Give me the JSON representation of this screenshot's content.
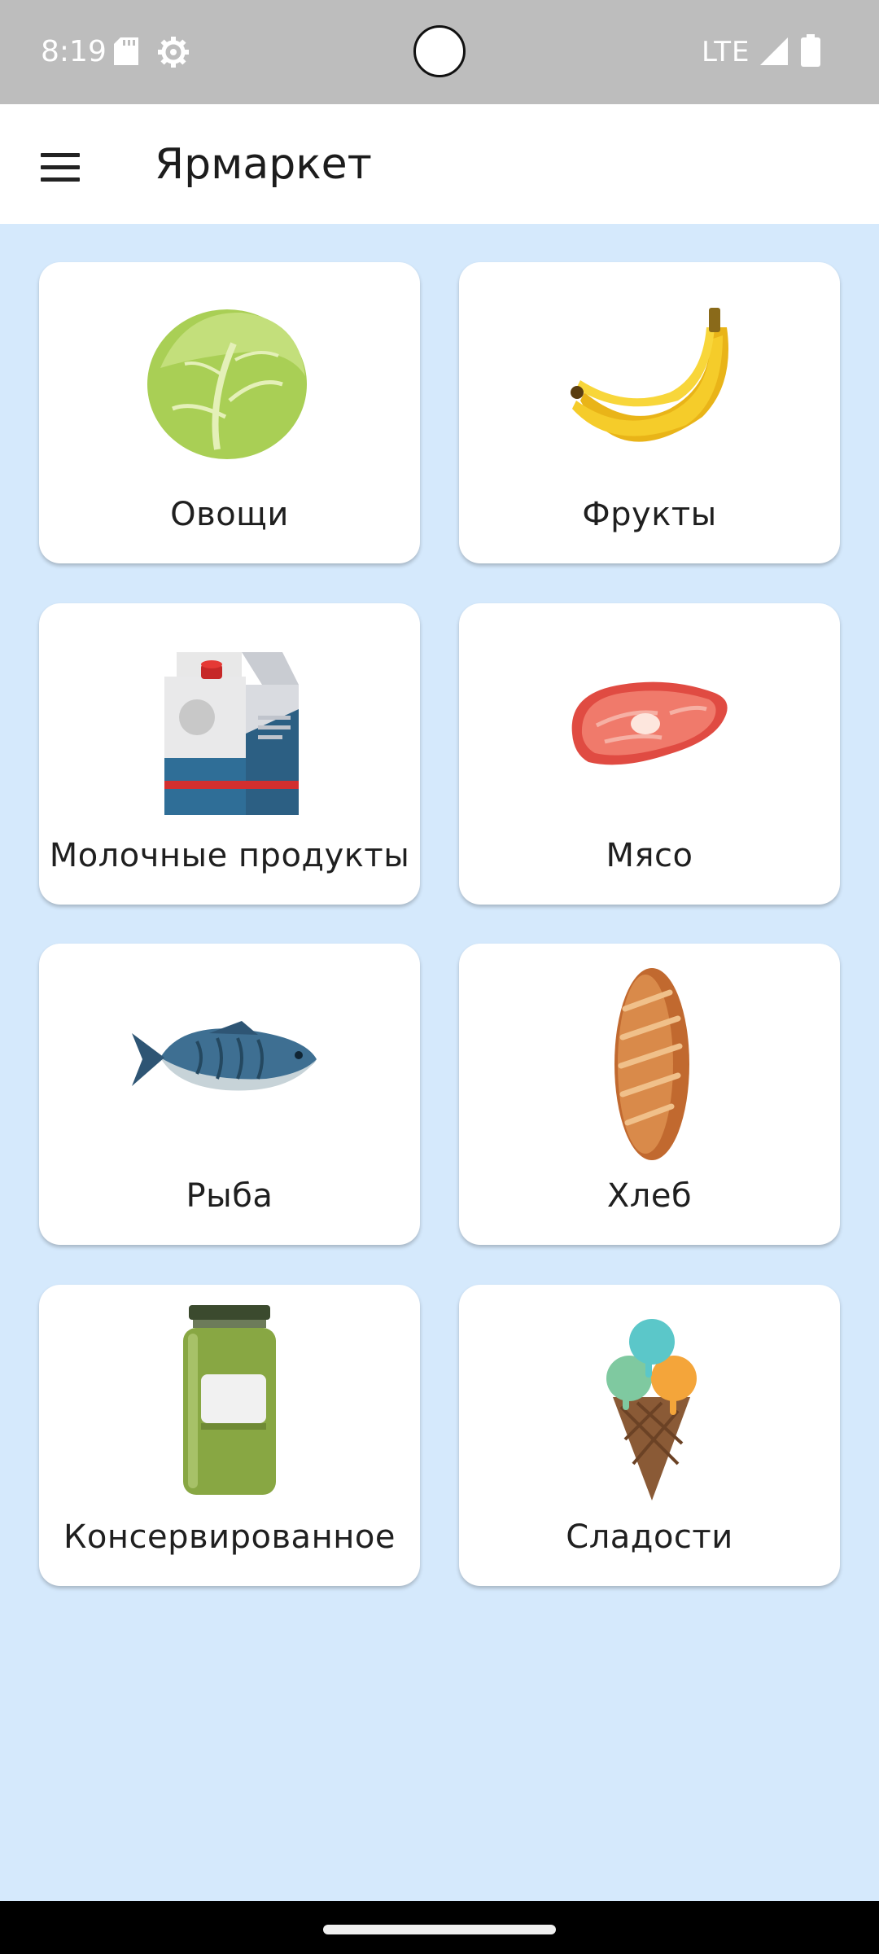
{
  "status_bar": {
    "time": "8:19",
    "network": "LTE",
    "icons": [
      "sd-card-icon",
      "gear-icon",
      "signal-icon",
      "battery-icon"
    ]
  },
  "app_bar": {
    "title": "Ярмаркет",
    "menu_icon": "menu-icon"
  },
  "categories": [
    {
      "label": "Овощи",
      "icon": "cabbage-icon"
    },
    {
      "label": "Фрукты",
      "icon": "banana-icon"
    },
    {
      "label": "Молочные продукты",
      "icon": "milk-carton-icon"
    },
    {
      "label": "Мясо",
      "icon": "steak-icon"
    },
    {
      "label": "Рыба",
      "icon": "fish-icon"
    },
    {
      "label": "Хлеб",
      "icon": "bread-icon"
    },
    {
      "label": "Консервированное",
      "icon": "jar-icon"
    },
    {
      "label": "Сладости",
      "icon": "ice-cream-icon"
    }
  ],
  "colors": {
    "background": "#d5e9fc",
    "status_bar": "#bdbdbd",
    "card": "#ffffff"
  }
}
